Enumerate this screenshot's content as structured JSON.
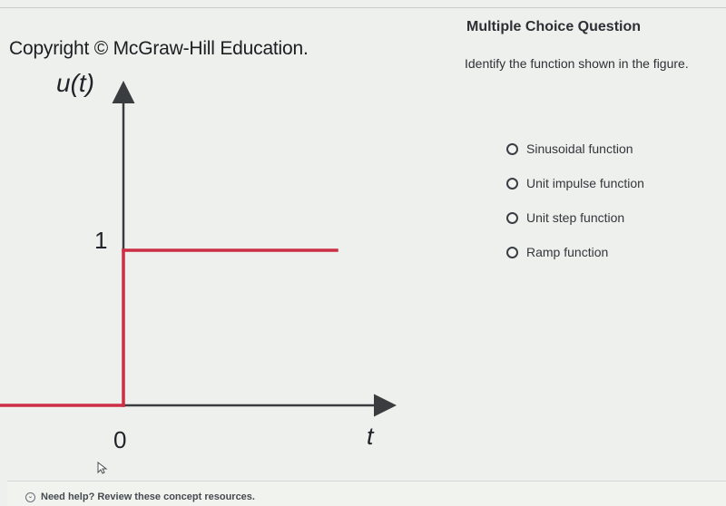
{
  "figure": {
    "copyright": "Copyright © McGraw-Hill Education.",
    "y_axis_label": "u(t)",
    "x_axis_label": "t",
    "level_label": "1",
    "origin_label": "0"
  },
  "chart_data": {
    "type": "line",
    "title": "",
    "xlabel": "t",
    "ylabel": "u(t)",
    "x": [
      -1,
      0,
      0,
      1
    ],
    "y": [
      0,
      0,
      1,
      1
    ],
    "ytick_labels": [
      "1"
    ],
    "xtick_labels": [
      "0"
    ],
    "line_color": "#cc2e45",
    "axis_color": "#3a3d40"
  },
  "question": {
    "type_label": "Multiple Choice Question",
    "prompt": "Identify the function shown in the figure.",
    "options": [
      {
        "label": "Sinusoidal function"
      },
      {
        "label": "Unit impulse function"
      },
      {
        "label": "Unit step function"
      },
      {
        "label": "Ramp function"
      }
    ]
  },
  "footer": {
    "help_text": "Need help? Review these concept resources."
  }
}
